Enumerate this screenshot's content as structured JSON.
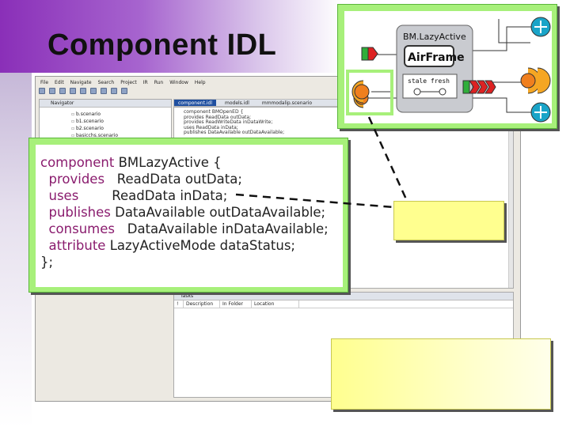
{
  "slide": {
    "title": "Component IDL"
  },
  "ide": {
    "menu": [
      "File",
      "Edit",
      "Navigate",
      "Search",
      "Project",
      "IR",
      "Run",
      "Window",
      "Help"
    ],
    "navigator_title": "Navigator",
    "navigator_items": [
      "b.scenario",
      "b1.scenario",
      "b2.scenario",
      "basicchs.scenario"
    ],
    "editor_tabs": [
      "component.idl",
      "models.idl",
      "mmmodalip.scenario"
    ],
    "editor_lines": [
      "component BMOpenED {",
      "provides  ReadData outData;",
      "provides  ReadWriteData inDataWrite;",
      "uses      ReadData inData;",
      "publishes DataAvailable outDataAvailable;"
    ],
    "tasks_title": "Tasks",
    "tasks_columns": [
      "!",
      "Description",
      "In Folder",
      "Location"
    ]
  },
  "code": {
    "lines": [
      {
        "kw": "component",
        "rest": " BMLazyActive {"
      },
      {
        "kw": "  provides",
        "rest": "   ReadData outData;"
      },
      {
        "kw": "  uses",
        "rest": "        ReadData inData;"
      },
      {
        "kw": "  publishes",
        "rest": " DataAvailable outDataAvailable;"
      },
      {
        "kw": "  consumes",
        "rest": "   DataAvailable inDataAvailable;"
      },
      {
        "kw": "  attribute",
        "rest": " LazyActiveMode dataStatus;"
      },
      {
        "kw": "};",
        "rest": ""
      }
    ]
  },
  "diagram": {
    "component_name": "BM.LazyActive",
    "implementation": "AirFrame",
    "attribute_label": "stale fresh"
  },
  "colors": {
    "callout_green": "#a7f07a",
    "callout_yellow": "#ffff8f",
    "keyword": "#8a1c6e",
    "title_band": "#8a2fb8"
  }
}
